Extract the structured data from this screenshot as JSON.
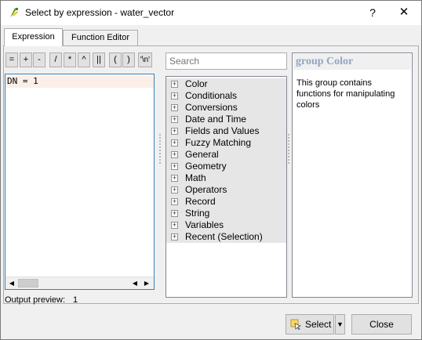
{
  "window": {
    "title": "Select by expression - water_vector",
    "help_glyph": "?",
    "close_glyph": "✕"
  },
  "tabs": [
    {
      "label": "Expression"
    },
    {
      "label": "Function Editor"
    }
  ],
  "operators": [
    "=",
    "+",
    "-",
    "/",
    "*",
    "^",
    "||",
    "(",
    ")",
    "'\\n'"
  ],
  "editor": {
    "text": "DN = 1"
  },
  "scrollbar": {
    "left_arrow": "◀",
    "right_arrow": "▶"
  },
  "search": {
    "placeholder": "Search"
  },
  "function_groups": [
    "Color",
    "Conditionals",
    "Conversions",
    "Date and Time",
    "Fields and Values",
    "Fuzzy Matching",
    "General",
    "Geometry",
    "Math",
    "Operators",
    "Record",
    "String",
    "Variables",
    "Recent (Selection)"
  ],
  "help": {
    "title": "group Color",
    "body": "This group contains functions for manipulating colors"
  },
  "preview": {
    "label": "Output preview:",
    "value": "1"
  },
  "buttons": {
    "select": "Select",
    "select_menu_glyph": "▼",
    "close": "Close"
  },
  "colors": {
    "accent_border": "#3c7fb1",
    "help_title": "#8fa6c1",
    "editor_line_highlight": "#fbefe8"
  }
}
